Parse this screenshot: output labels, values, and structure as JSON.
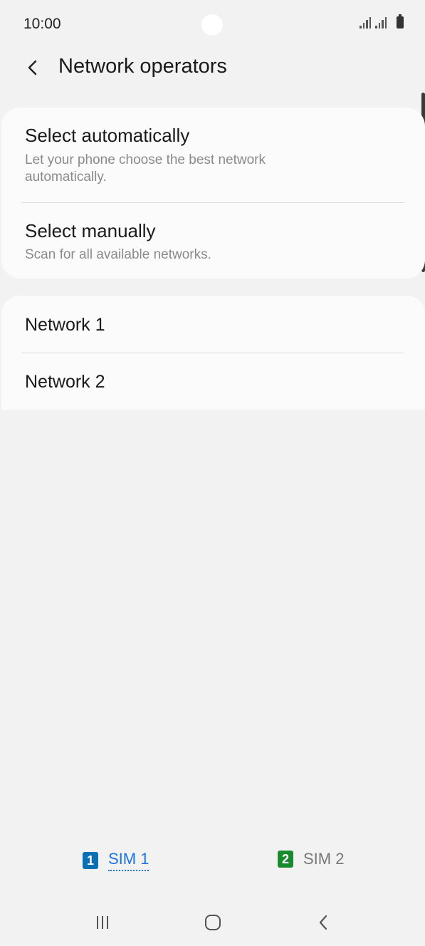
{
  "status_bar": {
    "time": "10:00"
  },
  "header": {
    "title": "Network operators"
  },
  "selection_options": [
    {
      "title": "Select automatically",
      "subtitle": "Let your phone choose the best network automatically."
    },
    {
      "title": "Select manually",
      "subtitle": "Scan for all available networks."
    }
  ],
  "networks": [
    {
      "name": "Network 1"
    },
    {
      "name": "Network 2"
    }
  ],
  "sim_tabs": [
    {
      "badge": "1",
      "label": "SIM 1",
      "active": true,
      "color": "#0a6fb5",
      "label_color": "#1a73e8"
    },
    {
      "badge": "2",
      "label": "SIM 2",
      "active": false,
      "color": "#1b8a2f",
      "label_color": "#777777"
    }
  ],
  "nav_bar": {
    "icons": [
      "recent-apps-icon",
      "home-icon",
      "back-icon"
    ]
  }
}
